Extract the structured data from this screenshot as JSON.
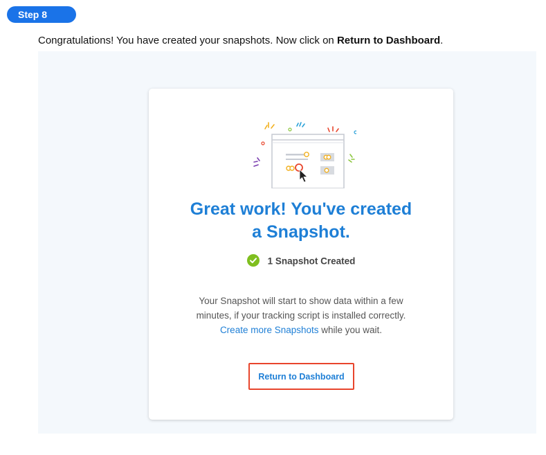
{
  "step": {
    "label": "Step 8"
  },
  "instruction": {
    "text_before": "Congratulations!  You have created your snapshots. Now click on ",
    "bold_text": "Return to Dashboard",
    "text_after": "."
  },
  "card": {
    "headline_line1": "Great work! You've created",
    "headline_line2": "a Snapshot.",
    "status_icon": "check-circle-icon",
    "status_text": "1 Snapshot Created",
    "body_line1": "Your Snapshot will start to show data within a few",
    "body_line2": "minutes, if your tracking script is installed correctly.",
    "link_text": "Create more Snapshots",
    "body_after_link": " while you wait.",
    "button_label": "Return to Dashboard"
  },
  "colors": {
    "step_pill": "#1a73e8",
    "headline": "#1e7fd6",
    "check": "#7fbf1f",
    "highlight": "#e8452c"
  }
}
